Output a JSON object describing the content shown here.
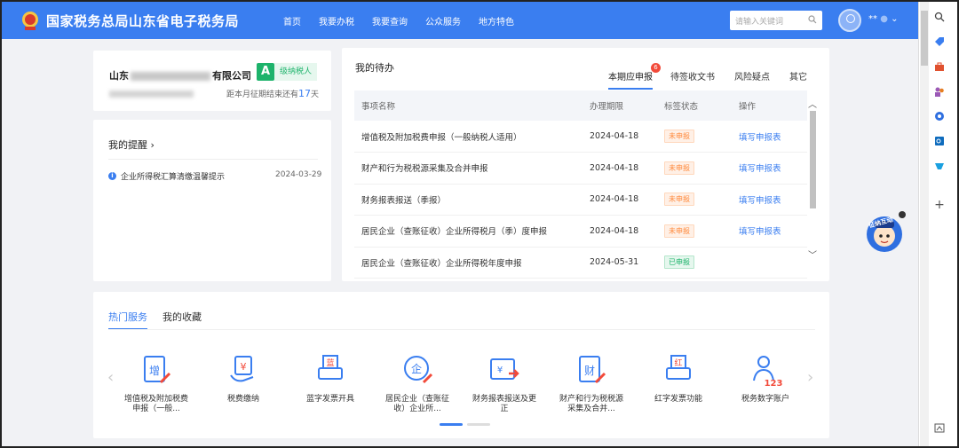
{
  "header": {
    "site_title": "国家税务总局山东省电子税务局",
    "nav": [
      "首页",
      "我要办税",
      "我要查询",
      "公众服务",
      "地方特色"
    ],
    "search_placeholder": "请输入关键词",
    "user_name": "**",
    "colors": {
      "primary": "#3a7ef0"
    }
  },
  "company": {
    "name_prefix": "山东",
    "name_suffix": "有限公司",
    "credit_level": "A",
    "credit_level_text": "级纳税人",
    "deadline_prefix": "距本月征期结束还有",
    "deadline_days": "17",
    "deadline_unit": "天"
  },
  "reminders": {
    "title": "我的提醒 ›",
    "items": [
      {
        "text": "企业所得税汇算清缴温馨提示",
        "date": "2024-03-29"
      }
    ]
  },
  "todo": {
    "title": "我的待办",
    "tabs": [
      {
        "label": "本期应申报",
        "badge": "6"
      },
      {
        "label": "待签收文书"
      },
      {
        "label": "风险疑点"
      },
      {
        "label": "其它"
      }
    ],
    "columns": [
      "事项名称",
      "办理期限",
      "标签状态",
      "操作"
    ],
    "rows": [
      {
        "name": "增值税及附加税费申报（一般纳税人适用）",
        "deadline": "2024-04-18",
        "status": "未申报",
        "action": "填写申报表"
      },
      {
        "name": "财产和行为税税源采集及合并申报",
        "deadline": "2024-04-18",
        "status": "未申报",
        "action": "填写申报表"
      },
      {
        "name": "财务报表报送（季报）",
        "deadline": "2024-04-18",
        "status": "未申报",
        "action": "填写申报表"
      },
      {
        "name": "居民企业（查账征收）企业所得税月（季）度申报",
        "deadline": "2024-04-18",
        "status": "未申报",
        "action": "填写申报表"
      },
      {
        "name": "居民企业（查账征收）企业所得税年度申报",
        "deadline": "2024-05-31",
        "status": "已申报",
        "action": ""
      }
    ]
  },
  "hot_services": {
    "tabs": [
      "热门服务",
      "我的收藏"
    ],
    "items": [
      {
        "label": "增值税及附加税费申报（一般...",
        "icon": "增"
      },
      {
        "label": "税费缴纳",
        "icon": "¥"
      },
      {
        "label": "蓝字发票开具",
        "icon": "蓝"
      },
      {
        "label": "居民企业（查账征收）企业所...",
        "icon": "企"
      },
      {
        "label": "财务报表报送及更正",
        "icon": "¥"
      },
      {
        "label": "财产和行为税税源采集及合并...",
        "icon": "财"
      },
      {
        "label": "红字发票功能",
        "icon": "红"
      },
      {
        "label": "税务数字账户",
        "icon": "123"
      }
    ]
  },
  "mascot_text": "征纳互动"
}
